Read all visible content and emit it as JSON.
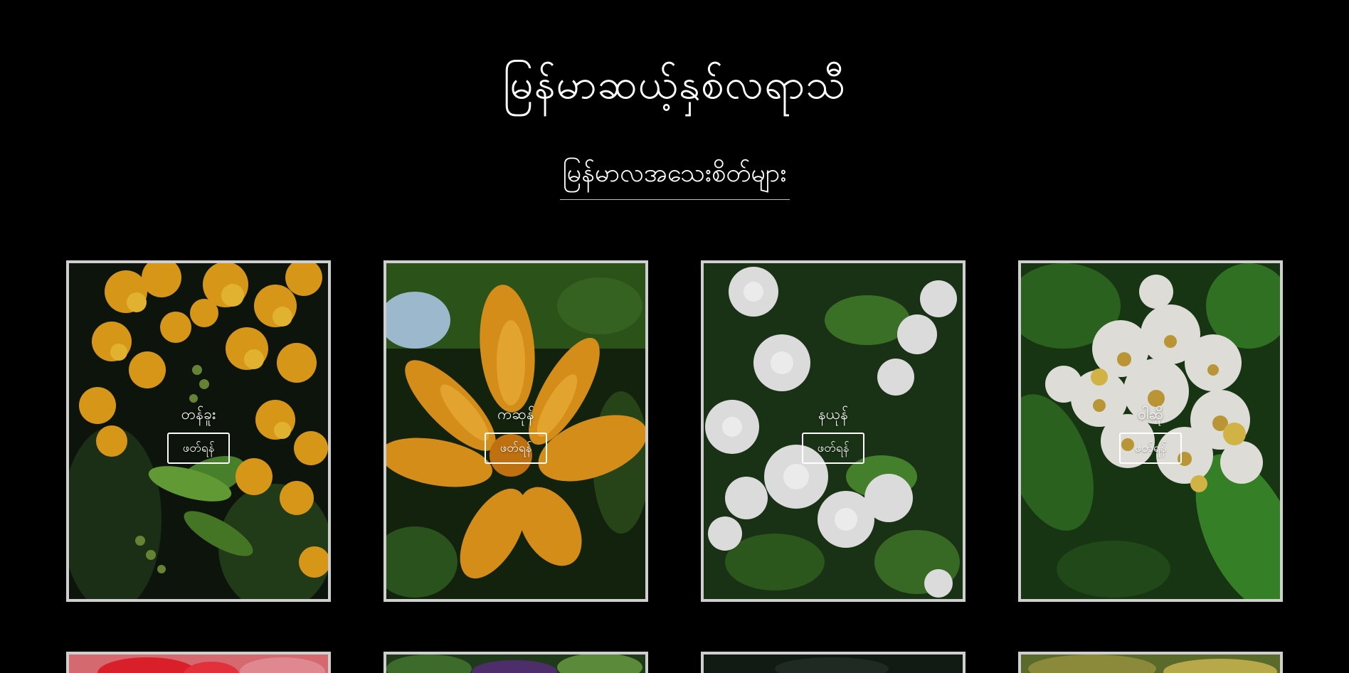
{
  "header": {
    "site_title": "မြန်မာဆယ့်နှစ်လရာသီ"
  },
  "section": {
    "heading": "မြန်မာလအသေးစိတ်များ"
  },
  "cards": [
    {
      "name": "တန်ခူး",
      "button_label": "ဖတ်ရန်",
      "flower": "yellow-padauk"
    },
    {
      "name": "ကဆုန်",
      "button_label": "ဖတ်ရန်",
      "flower": "orange-champak"
    },
    {
      "name": "နယုန်",
      "button_label": "ဖတ်ရန်",
      "flower": "white-jasmine"
    },
    {
      "name": "ဝါဆို",
      "button_label": "ဖတ်ရန်",
      "flower": "white-cluster-blossom"
    }
  ],
  "colors": {
    "background": "#000000",
    "card_border": "#cfcfcf",
    "text": "#ffffff"
  }
}
